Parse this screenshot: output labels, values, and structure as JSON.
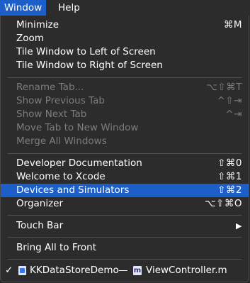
{
  "menubar": {
    "window_label": "Window",
    "help_label": "Help"
  },
  "menu": {
    "groups": [
      {
        "items": [
          {
            "label": "Minimize",
            "shortcut": "⌘M",
            "enabled": true
          },
          {
            "label": "Zoom",
            "shortcut": "",
            "enabled": true
          },
          {
            "label": "Tile Window to Left of Screen",
            "shortcut": "",
            "enabled": true
          },
          {
            "label": "Tile Window to Right of Screen",
            "shortcut": "",
            "enabled": true
          }
        ]
      },
      {
        "items": [
          {
            "label": "Rename Tab...",
            "shortcut": "⌥⇧⌘T",
            "enabled": false
          },
          {
            "label": "Show Previous Tab",
            "shortcut": "^⇧⇥",
            "enabled": false
          },
          {
            "label": "Show Next Tab",
            "shortcut": "^⇥",
            "enabled": false
          },
          {
            "label": "Move Tab to New Window",
            "shortcut": "",
            "enabled": false
          },
          {
            "label": "Merge All Windows",
            "shortcut": "",
            "enabled": false
          }
        ]
      },
      {
        "items": [
          {
            "label": "Developer Documentation",
            "shortcut": "⇧⌘0",
            "enabled": true
          },
          {
            "label": "Welcome to Xcode",
            "shortcut": "⇧⌘1",
            "enabled": true
          },
          {
            "label": "Devices and Simulators",
            "shortcut": "⇧⌘2",
            "enabled": true,
            "highlighted": true
          },
          {
            "label": "Organizer",
            "shortcut": "⌥⇧⌘O",
            "enabled": true
          }
        ]
      },
      {
        "items": [
          {
            "label": "Touch Bar",
            "shortcut": "▶",
            "enabled": true
          }
        ]
      },
      {
        "items": [
          {
            "label": "Bring All to Front",
            "shortcut": "",
            "enabled": true
          }
        ]
      }
    ],
    "window_entry": {
      "checkmark": "✓",
      "project": "KKDataStoreDemo",
      "separator": "—",
      "file_icon_letter": "m",
      "file": "ViewController.m"
    }
  },
  "colors": {
    "highlight": "#1c5fc9",
    "disabled_text": "#7d7c7c",
    "menu_background": "#2d2c2c"
  }
}
